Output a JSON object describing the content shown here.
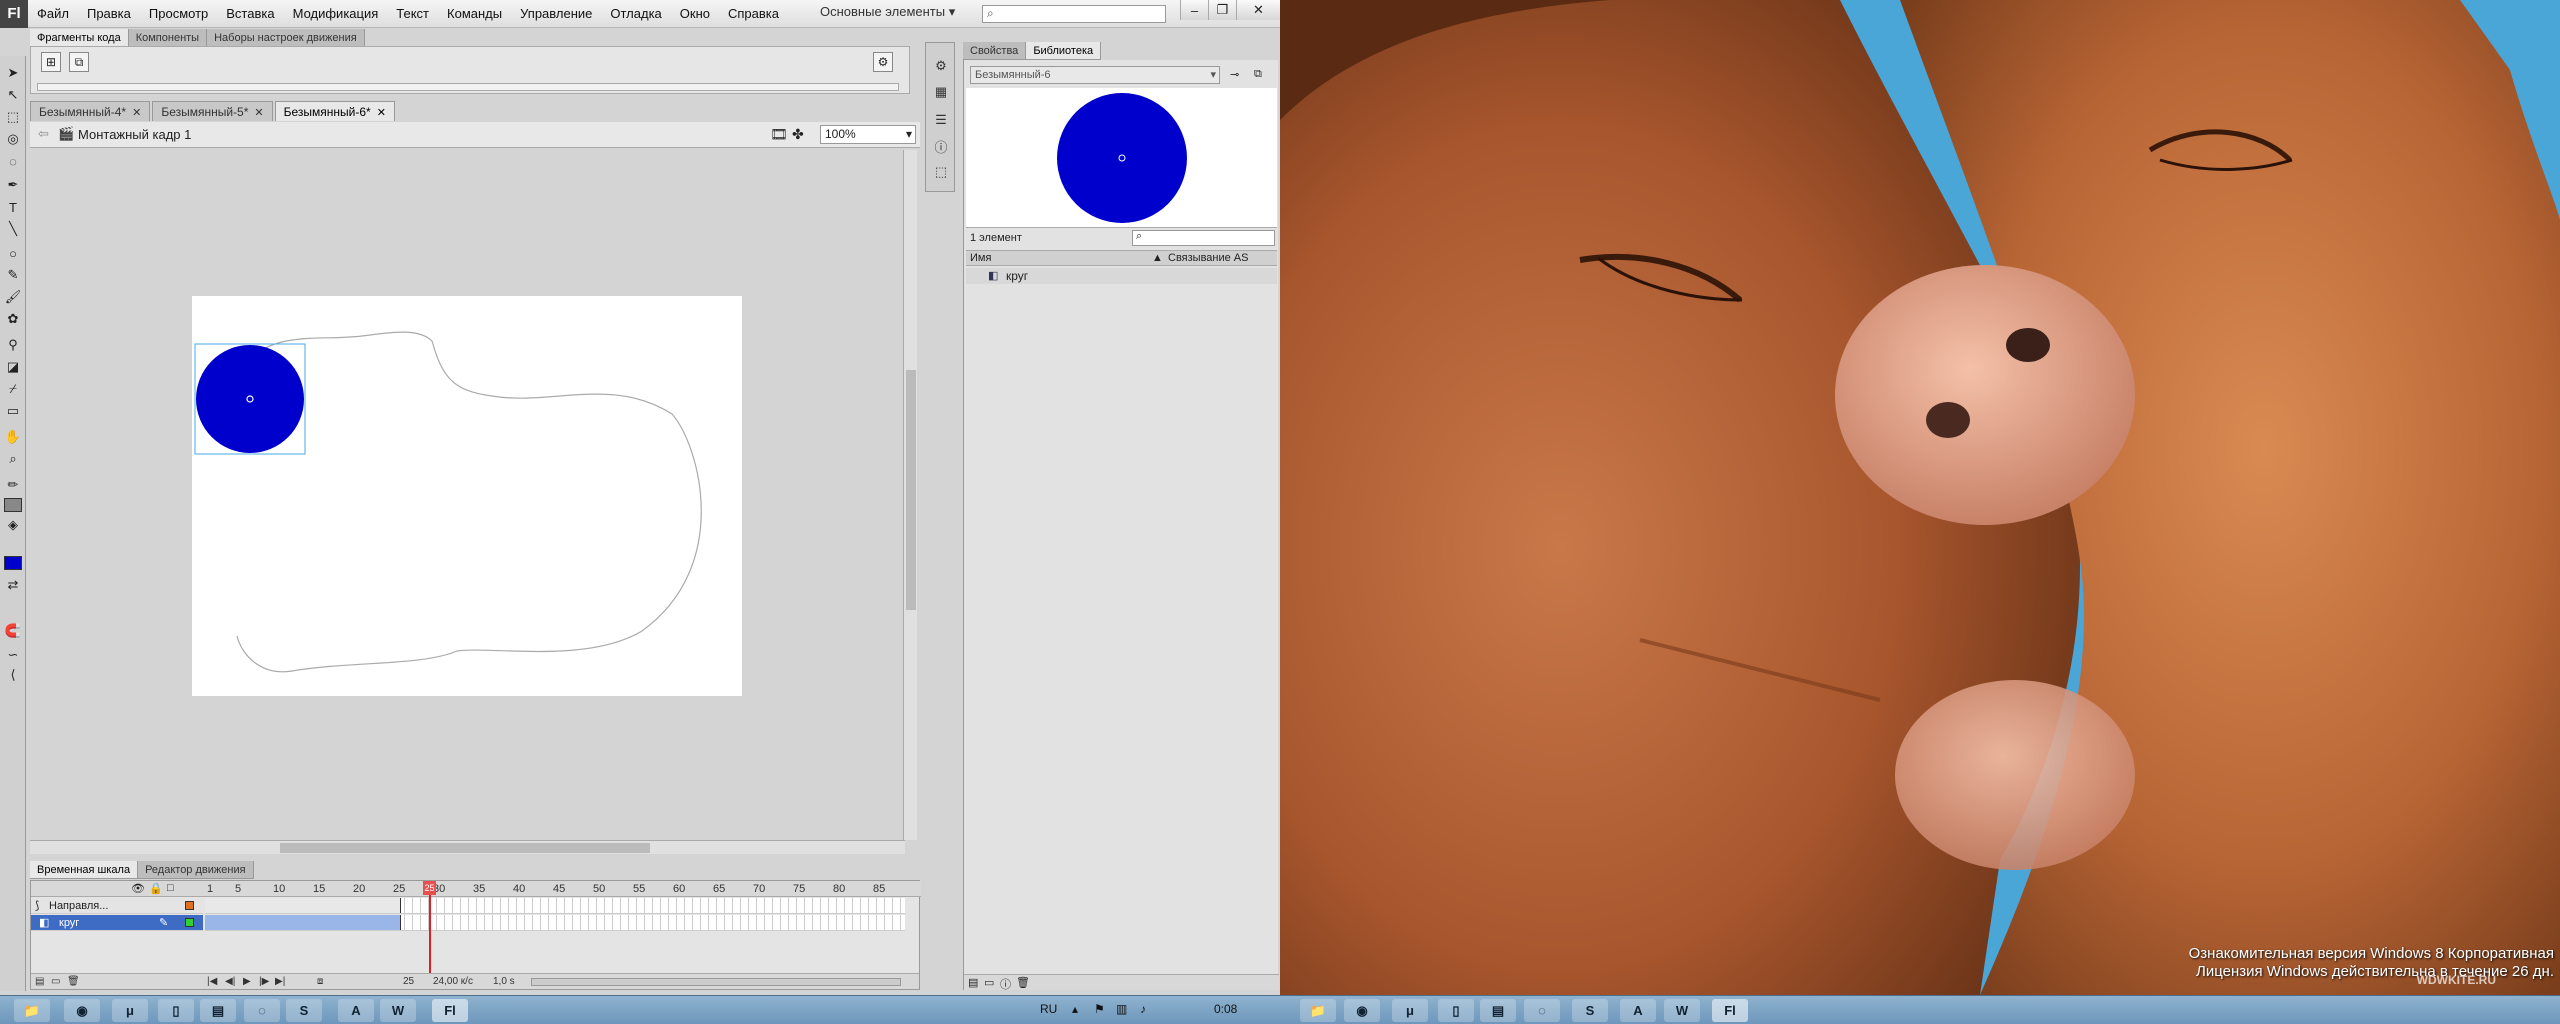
{
  "app": {
    "logo": "Fl",
    "menu": [
      "Файл",
      "Правка",
      "Просмотр",
      "Вставка",
      "Модификация",
      "Текст",
      "Команды",
      "Управление",
      "Отладка",
      "Окно",
      "Справка"
    ],
    "workspace": "Основные элементы",
    "window_buttons": {
      "minimize": "–",
      "restore": "❐",
      "close": "✕"
    }
  },
  "snippets_panel": {
    "tabs": [
      "Фрагменты кода",
      "Компоненты",
      "Наборы настроек движения"
    ]
  },
  "documents": {
    "tabs": [
      "Безымянный-4*",
      "Безымянный-5*",
      "Безымянный-6*"
    ],
    "active": "Безымянный-6*",
    "close_glyph": "✕"
  },
  "editbar": {
    "scene": "Монтажный кадр 1",
    "zoom": "100%"
  },
  "stage": {
    "circle_color": "#0000cc",
    "background": "#ffffff"
  },
  "timeline": {
    "tabs": [
      "Временная шкала",
      "Редактор движения"
    ],
    "frame_numbers": [
      "1",
      "5",
      "10",
      "15",
      "20",
      "25",
      "30",
      "35",
      "40",
      "45",
      "50",
      "55",
      "60",
      "65",
      "70",
      "75",
      "80",
      "85"
    ],
    "layers": [
      {
        "name": "Направля...",
        "selected": false
      },
      {
        "name": "круг",
        "selected": true
      }
    ],
    "current_frame": "25",
    "fps": "24,00 к/с",
    "time": "1,0 s"
  },
  "library": {
    "tabs": [
      "Свойства",
      "Библиотека"
    ],
    "document": "Безымянный-6",
    "count": "1 элемент",
    "columns": {
      "name": "Имя",
      "linkage": "Связывание AS"
    },
    "items": [
      "круг"
    ]
  },
  "desktop": {
    "watermark_line1": "Ознакомительная версия Windows 8 Корпоративная",
    "watermark_line2": "Лицензия Windows действительна в течение 26 дн.",
    "site": "WDWKITE.RU"
  },
  "taskbar": {
    "language": "RU",
    "clock": "0:08"
  }
}
